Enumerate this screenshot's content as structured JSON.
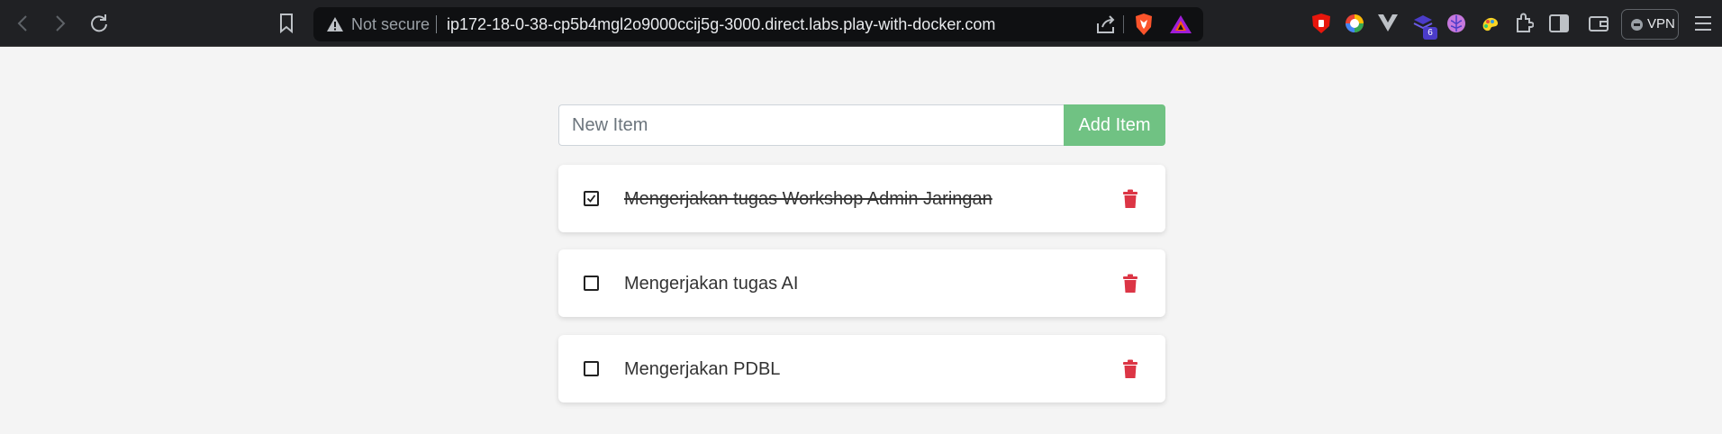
{
  "browser": {
    "security_label": "Not secure",
    "url": "ip172-18-0-38-cp5b4mgl2o9000ccij5g-3000.direct.labs.play-with-docker.com",
    "extension_badge": "6",
    "vpn_label": "VPN"
  },
  "colors": {
    "accent_green": "#70c283",
    "delete_red": "#dc3545"
  },
  "form": {
    "input_value": "",
    "input_placeholder": "New Item",
    "add_label": "Add Item"
  },
  "items": [
    {
      "label": "Mengerjakan tugas Workshop Admin Jaringan",
      "completed": true
    },
    {
      "label": "Mengerjakan tugas AI",
      "completed": false
    },
    {
      "label": "Mengerjakan PDBL",
      "completed": false
    }
  ]
}
